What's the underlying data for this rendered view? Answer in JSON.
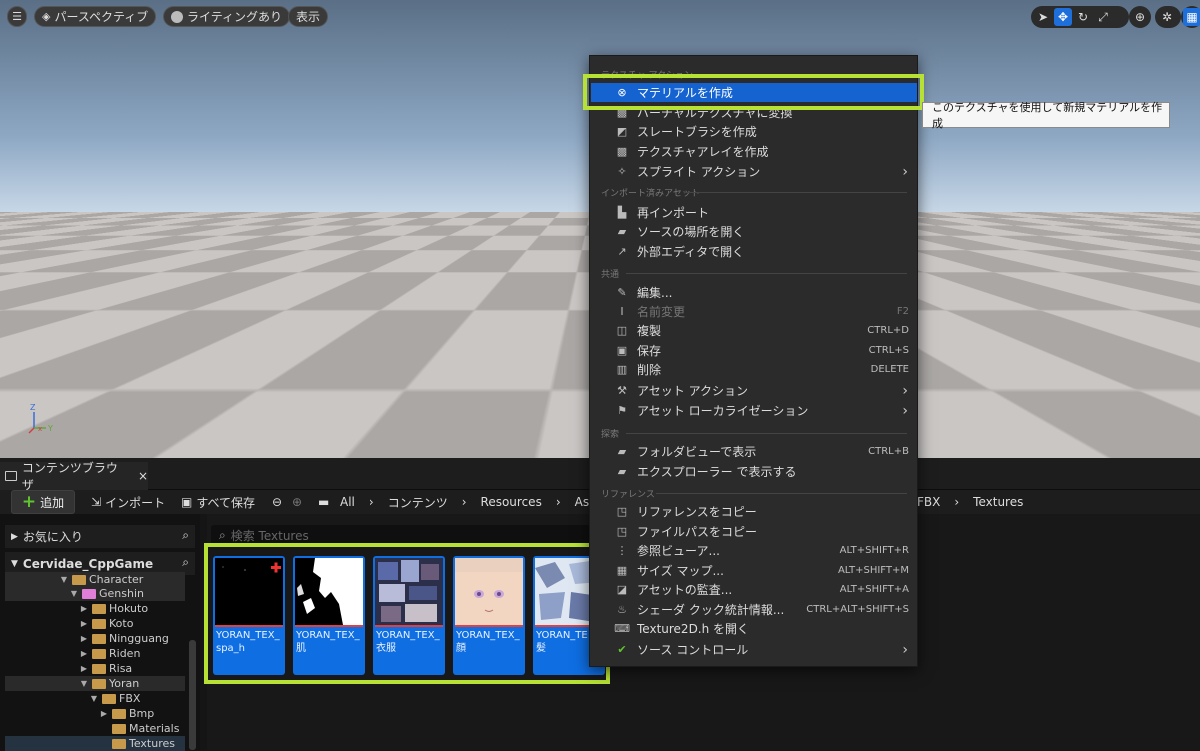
{
  "viewport": {
    "perspective_label": "パースペクティブ",
    "lighting_label": "ライティングあり",
    "show_label": "表示"
  },
  "content_browser": {
    "tab_label": "コンテンツブラウザ",
    "tab_close": "×",
    "toolbar": {
      "add_label": "追加",
      "import_label": "インポート",
      "save_all_label": "すべて保存",
      "breadcrumb": [
        "All",
        "コンテンツ",
        "Resources",
        "Asse",
        "FBX",
        "Textures"
      ]
    },
    "search_placeholder": "検索 Textures",
    "sidebar": {
      "favorites_label": "お気に入り",
      "project_label": "Cervidae_CppGame",
      "tree": [
        {
          "label": "Character",
          "indent": 0
        },
        {
          "label": "Genshin",
          "indent": 1
        },
        {
          "label": "Hokuto",
          "indent": 2
        },
        {
          "label": "Koto",
          "indent": 2
        },
        {
          "label": "Ningguang",
          "indent": 2
        },
        {
          "label": "Riden",
          "indent": 2
        },
        {
          "label": "Risa",
          "indent": 2
        },
        {
          "label": "Yoran",
          "indent": 2
        },
        {
          "label": "FBX",
          "indent": 3
        },
        {
          "label": "Bmp",
          "indent": 4
        },
        {
          "label": "Materials",
          "indent": 4
        },
        {
          "label": "Textures",
          "indent": 4
        }
      ]
    },
    "assets": [
      {
        "name": "YORAN_TEX_\nspa_h"
      },
      {
        "name": "YORAN_TEX_\n肌"
      },
      {
        "name": "YORAN_TEX_\n衣服"
      },
      {
        "name": "YORAN_TEX_\n顔"
      },
      {
        "name": "YORAN_TE\n髪"
      }
    ]
  },
  "context_menu": {
    "sections": [
      {
        "title": "テクスチャ アクション"
      },
      {
        "title": "インポート済みアセット"
      },
      {
        "title": "共通"
      },
      {
        "title": "探索"
      },
      {
        "title": "リファレンス"
      }
    ],
    "items": [
      {
        "label": "マテリアルを作成",
        "icon": "material-icon"
      },
      {
        "label": "バーチャルテクスチャに変換",
        "icon": "virtual-texture-icon"
      },
      {
        "label": "スレートブラシを作成",
        "icon": "brush-icon"
      },
      {
        "label": "テクスチャアレイを作成",
        "icon": "texture-array-icon"
      },
      {
        "label": "スプライト アクション",
        "icon": "sprite-icon"
      },
      {
        "label": "再インポート",
        "icon": "reimport-icon"
      },
      {
        "label": "ソースの場所を開く",
        "icon": "folder-icon"
      },
      {
        "label": "外部エディタで開く",
        "icon": "external-icon"
      },
      {
        "label": "編集...",
        "icon": "edit-icon"
      },
      {
        "label": "名前変更",
        "icon": "rename-icon",
        "shortcut": "F2"
      },
      {
        "label": "複製",
        "icon": "duplicate-icon",
        "shortcut": "CTRL+D"
      },
      {
        "label": "保存",
        "icon": "save-icon",
        "shortcut": "CTRL+S"
      },
      {
        "label": "削除",
        "icon": "delete-icon",
        "shortcut": "DELETE"
      },
      {
        "label": "アセット アクション",
        "icon": "wrench-icon"
      },
      {
        "label": "アセット ローカライゼーション",
        "icon": "flag-icon"
      },
      {
        "label": "フォルダビューで表示",
        "icon": "folder-view-icon",
        "shortcut": "CTRL+B"
      },
      {
        "label": "エクスプローラー で表示する",
        "icon": "explorer-icon"
      },
      {
        "label": "リファレンスをコピー",
        "icon": "copy-ref-icon"
      },
      {
        "label": "ファイルパスをコピー",
        "icon": "copy-path-icon"
      },
      {
        "label": "参照ビューア...",
        "icon": "reference-viewer-icon",
        "shortcut": "ALT+SHIFT+R"
      },
      {
        "label": "サイズ マップ...",
        "icon": "size-map-icon",
        "shortcut": "ALT+SHIFT+M"
      },
      {
        "label": "アセットの監査...",
        "icon": "audit-icon",
        "shortcut": "ALT+SHIFT+A"
      },
      {
        "label": "シェーダ クック統計情報...",
        "icon": "shader-icon",
        "shortcut": "CTRL+ALT+SHIFT+S"
      },
      {
        "label": "Texture2D.h を開く",
        "icon": "code-icon"
      },
      {
        "label": "ソース コントロール",
        "icon": "source-control-icon"
      }
    ]
  },
  "tooltip": "このテクスチャを使用して新規マテリアルを作成",
  "colors": {
    "highlight_outline": "#b7e235",
    "selection_blue": "#0e6ee2",
    "menu_active": "#1463d0"
  }
}
